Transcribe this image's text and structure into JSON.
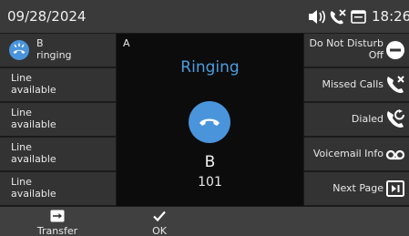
{
  "status": {
    "date": "09/28/2024",
    "time": "18:26",
    "icons": [
      "speaker-icon",
      "missed-call-icon",
      "screen-icon"
    ]
  },
  "lines": [
    {
      "line1": "B",
      "line2": "ringing",
      "icon": "ringing-call-icon"
    },
    {
      "line1": "Line",
      "line2": "available"
    },
    {
      "line1": "Line",
      "line2": "available"
    },
    {
      "line1": "Line",
      "line2": "available"
    },
    {
      "line1": "Line",
      "line2": "available"
    }
  ],
  "call": {
    "line": "A",
    "state": "Ringing",
    "name": "B",
    "number": "101",
    "accent": "#4a94db"
  },
  "functions": [
    {
      "label1": "Do Not Disturb",
      "label2": "Off",
      "icon": "do-not-disturb-icon"
    },
    {
      "label1": "Missed Calls",
      "icon": "missed-calls-icon"
    },
    {
      "label1": "Dialed",
      "icon": "dialed-calls-icon"
    },
    {
      "label1": "Voicemail Info",
      "icon": "voicemail-icon"
    },
    {
      "label1": "Next Page",
      "icon": "next-page-icon"
    }
  ],
  "softkeys": [
    {
      "label": "Transfer",
      "icon": "transfer-icon"
    },
    {
      "label": "OK",
      "icon": "checkmark-icon"
    }
  ]
}
